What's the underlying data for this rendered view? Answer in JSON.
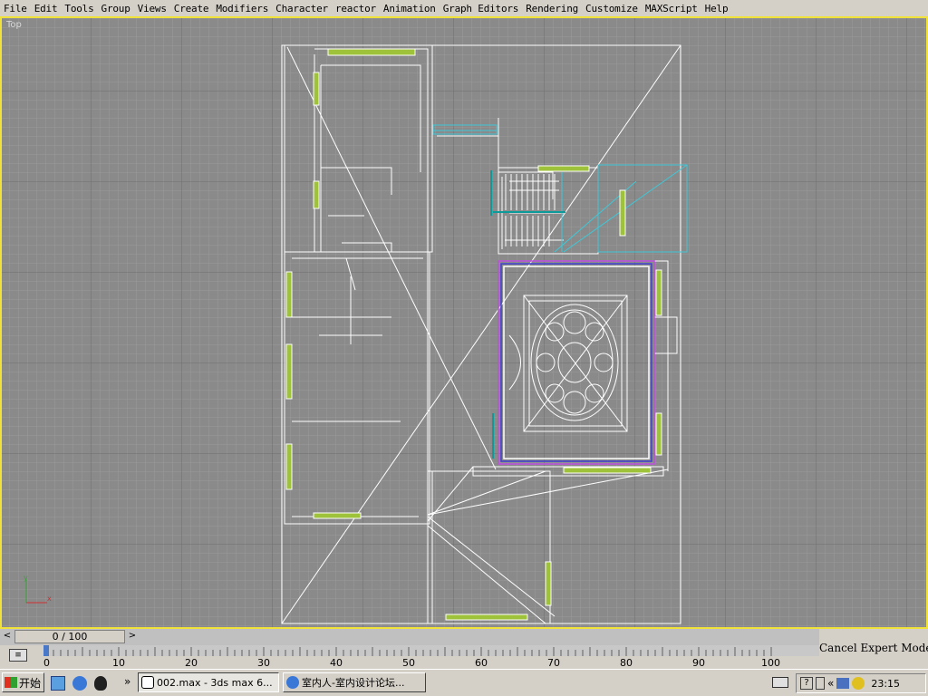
{
  "menubar": {
    "items": [
      "File",
      "Edit",
      "Tools",
      "Group",
      "Views",
      "Create",
      "Modifiers",
      "Character",
      "reactor",
      "Animation",
      "Graph Editors",
      "Rendering",
      "Customize",
      "MAXScript",
      "Help"
    ]
  },
  "viewport": {
    "label": "Top",
    "background": "#8a8a8a",
    "active_border": "#f1e23a",
    "axis": {
      "y": "y",
      "x": "x"
    }
  },
  "timeline": {
    "slider_text": "0 / 100",
    "ticks": [
      "0",
      "10",
      "20",
      "30",
      "40",
      "50",
      "60",
      "70",
      "80",
      "90",
      "100"
    ]
  },
  "status": {
    "expert_text": "Cancel Expert Mode"
  },
  "taskbar": {
    "start_label": "开始",
    "tasks": [
      {
        "label": "002.max - 3ds max 6..."
      },
      {
        "label": "室内人-室内设计论坛..."
      }
    ],
    "clock": "23:15",
    "chevrons": "»",
    "tray_chevron": "«"
  }
}
